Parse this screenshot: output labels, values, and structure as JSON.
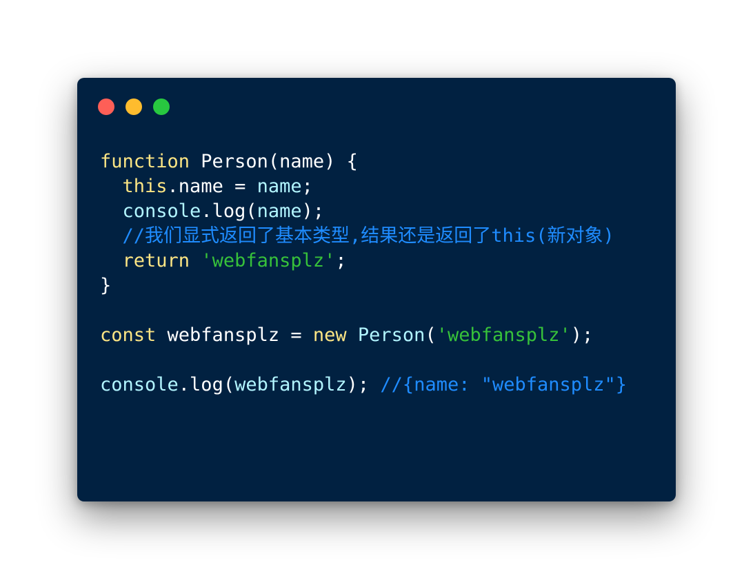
{
  "colors": {
    "background": "#012141",
    "default_text": "#ffffff",
    "keyword": "#fce584",
    "identifier": "#b2f5ff",
    "string": "#37c13a",
    "comment": "#1f8cff",
    "dot_close": "#fe5f57",
    "dot_minimize": "#febc2e",
    "dot_maximize": "#28c840"
  },
  "window": {
    "controls": [
      {
        "name": "close-dot",
        "color": "#fe5f57"
      },
      {
        "name": "minimize-dot",
        "color": "#febc2e"
      },
      {
        "name": "maximize-dot",
        "color": "#28c840"
      }
    ]
  },
  "code_lines": [
    {
      "tokens": [
        {
          "text": "function",
          "kind": "keyword"
        },
        {
          "text": " Person(name) {",
          "kind": "plain"
        }
      ]
    },
    {
      "tokens": [
        {
          "text": "  ",
          "kind": "plain"
        },
        {
          "text": "this",
          "kind": "keyword"
        },
        {
          "text": ".name = ",
          "kind": "plain"
        },
        {
          "text": "name",
          "kind": "identifier"
        },
        {
          "text": ";",
          "kind": "plain"
        }
      ]
    },
    {
      "tokens": [
        {
          "text": "  ",
          "kind": "plain"
        },
        {
          "text": "console",
          "kind": "identifier"
        },
        {
          "text": ".log(",
          "kind": "plain"
        },
        {
          "text": "name",
          "kind": "identifier"
        },
        {
          "text": ");",
          "kind": "plain"
        }
      ]
    },
    {
      "tokens": [
        {
          "text": "  ",
          "kind": "plain"
        },
        {
          "text": "//我们显式返回了基本类型,结果还是返回了this(新对象)",
          "kind": "comment"
        }
      ]
    },
    {
      "tokens": [
        {
          "text": "  ",
          "kind": "plain"
        },
        {
          "text": "return",
          "kind": "keyword"
        },
        {
          "text": " ",
          "kind": "plain"
        },
        {
          "text": "'webfansplz'",
          "kind": "string"
        },
        {
          "text": ";",
          "kind": "plain"
        }
      ]
    },
    {
      "tokens": [
        {
          "text": "}",
          "kind": "plain"
        }
      ]
    },
    {
      "tokens": [],
      "blank": true
    },
    {
      "tokens": [
        {
          "text": "const",
          "kind": "keyword"
        },
        {
          "text": " webfansplz = ",
          "kind": "plain"
        },
        {
          "text": "new",
          "kind": "keyword"
        },
        {
          "text": " ",
          "kind": "plain"
        },
        {
          "text": "Person",
          "kind": "identifier"
        },
        {
          "text": "(",
          "kind": "plain"
        },
        {
          "text": "'webfansplz'",
          "kind": "string"
        },
        {
          "text": ");",
          "kind": "plain"
        }
      ]
    },
    {
      "tokens": [],
      "blank": true
    },
    {
      "tokens": [
        {
          "text": "console",
          "kind": "identifier"
        },
        {
          "text": ".log(",
          "kind": "plain"
        },
        {
          "text": "webfansplz",
          "kind": "identifier"
        },
        {
          "text": "); ",
          "kind": "plain"
        },
        {
          "text": "//{name: \"webfansplz\"}",
          "kind": "comment"
        }
      ]
    }
  ]
}
